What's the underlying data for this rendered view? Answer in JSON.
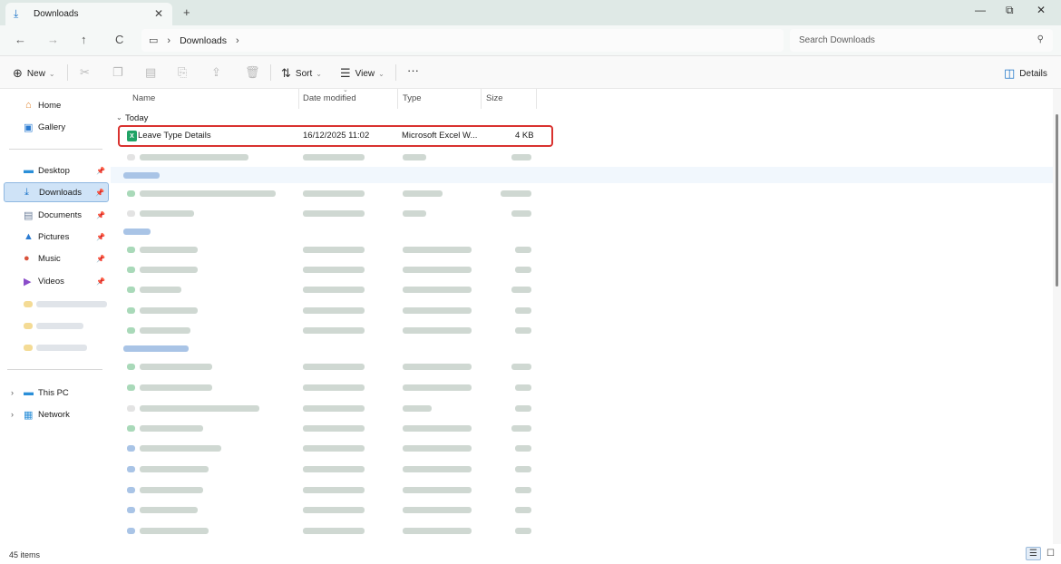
{
  "window": {
    "tab_title": "Downloads",
    "tab_icon": "download-icon",
    "new_tab": "+",
    "controls": [
      "—",
      "⧉",
      "✕"
    ]
  },
  "nav": {
    "back": "←",
    "forward": "→",
    "up": "↑",
    "refresh": "C",
    "breadcrumb": [
      "Downloads"
    ],
    "search_placeholder": "Search Downloads"
  },
  "commandbar": {
    "new_label": "New",
    "sort_label": "Sort",
    "view_label": "View",
    "more_label": "···",
    "details_label": "Details"
  },
  "sidebar": {
    "items": [
      {
        "label": "Home",
        "icon": "home-icon"
      },
      {
        "label": "Gallery",
        "icon": "gallery-icon"
      },
      {
        "label": "Desktop",
        "icon": "desktop-icon",
        "pinned": true
      },
      {
        "label": "Downloads",
        "icon": "download-icon",
        "pinned": true,
        "selected": true
      },
      {
        "label": "Documents",
        "icon": "documents-icon",
        "pinned": true
      },
      {
        "label": "Pictures",
        "icon": "pictures-icon",
        "pinned": true
      },
      {
        "label": "Music",
        "icon": "music-icon",
        "pinned": true
      },
      {
        "label": "Videos",
        "icon": "videos-icon",
        "pinned": true
      },
      {
        "label": "This PC",
        "icon": "computer-icon"
      },
      {
        "label": "Network",
        "icon": "network-icon"
      }
    ]
  },
  "columns": [
    "Name",
    "Date modified",
    "Type",
    "Size"
  ],
  "groups": {
    "today": "Today"
  },
  "files": [
    {
      "name": "Leave Type Details",
      "date": "16/12/2025 11:02",
      "type": "Microsoft Excel W...",
      "size": "4 KB",
      "icon": "excel-icon",
      "highlighted": true
    }
  ],
  "status": {
    "item_count": "45 items"
  },
  "colors": {
    "accent": "#1a73c8",
    "highlight_border": "#d9322f",
    "selected_bg": "#cfe3f7",
    "excel_green": "#21a366"
  }
}
